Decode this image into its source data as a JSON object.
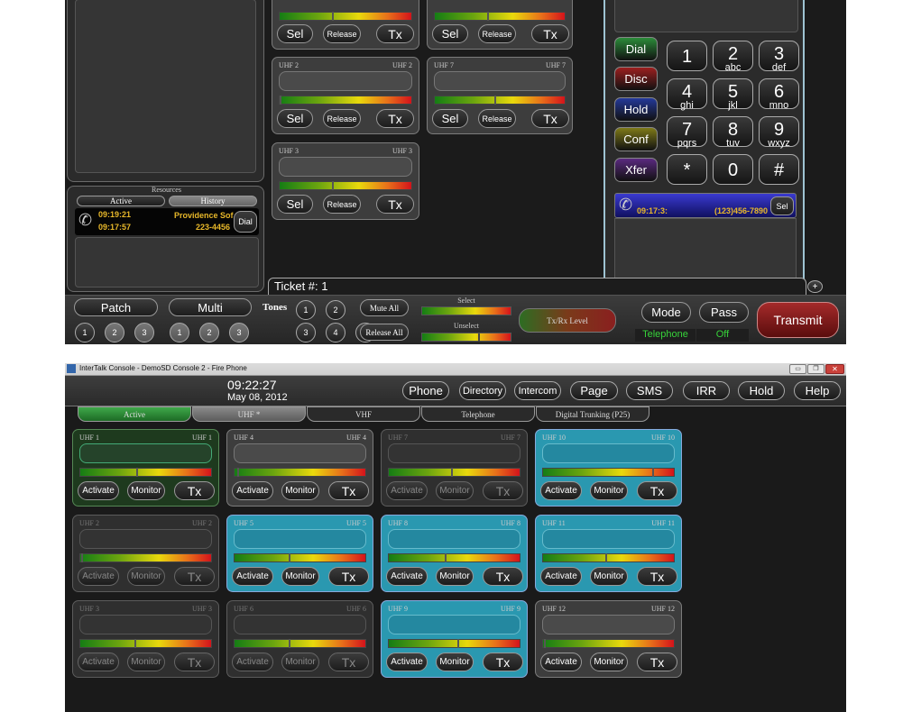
{
  "top": {
    "resources": {
      "title": "Resources",
      "tab_active": "Active",
      "tab_history": "History",
      "call": {
        "time1": "09:19:21",
        "time2": "09:17:57",
        "name": "Providence Sof",
        "number": "223-4456",
        "dial": "Dial"
      }
    },
    "channels": [
      {
        "left": "UHF 2",
        "right": "UHF 2",
        "sel": "Sel",
        "release": "Release",
        "tx": "Tx"
      },
      {
        "left": "UHF 7",
        "right": "UHF 7",
        "sel": "Sel",
        "release": "Release",
        "tx": "Tx"
      },
      {
        "left": "UHF 3",
        "right": "UHF 3",
        "sel": "Sel",
        "release": "Release",
        "tx": "Tx"
      }
    ],
    "partial_row": {
      "sel": "Sel",
      "release": "Release",
      "tx": "Tx"
    },
    "dialer": {
      "call_buttons": [
        "Dial",
        "Disc",
        "Hold",
        "Conf",
        "Xfer"
      ],
      "call_colors": [
        "#2c8c3a",
        "#9c1f1f",
        "#24399a",
        "#7f7a18",
        "#5a2a80"
      ],
      "keys": [
        {
          "n": "1",
          "l": ""
        },
        {
          "n": "2",
          "l": "abc"
        },
        {
          "n": "3",
          "l": "def"
        },
        {
          "n": "4",
          "l": "ghi"
        },
        {
          "n": "5",
          "l": "jkl"
        },
        {
          "n": "6",
          "l": "mno"
        },
        {
          "n": "7",
          "l": "pqrs"
        },
        {
          "n": "8",
          "l": "tuv"
        },
        {
          "n": "9",
          "l": "wxyz"
        },
        {
          "n": "*",
          "l": ""
        },
        {
          "n": "0",
          "l": ""
        },
        {
          "n": "#",
          "l": ""
        }
      ],
      "active_call": {
        "time": "09:17:3:",
        "number": "(123)456-7890",
        "sel": "Sel"
      }
    },
    "ticket": "Ticket #:  1",
    "plus": "+",
    "bottom": {
      "patch": "Patch",
      "multi": "Multi",
      "tones": "Tones",
      "patch_nums": [
        "1",
        "2",
        "3"
      ],
      "multi_nums": [
        "1",
        "2",
        "3"
      ],
      "tone_nums": [
        "1",
        "2",
        "3",
        "4",
        "5"
      ],
      "mute_all": "Mute All",
      "release_all": "Release All",
      "select": "Select",
      "unselect": "Unselect",
      "txrx": "Tx/Rx Level",
      "mode": "Mode",
      "pass": "Pass",
      "mode_value": "Telephone",
      "pass_value": "Off",
      "transmit": "Transmit"
    }
  },
  "bottom_window": {
    "title": "InterTalk Console - DemoSD Console 2 - Fire Phone",
    "time": "09:22:27",
    "date": "May 08, 2012",
    "nav": [
      "Phone",
      "Directory",
      "Intercom",
      "Page",
      "SMS",
      "IRR",
      "Hold",
      "Help"
    ],
    "tabs": [
      "Active",
      "UHF *",
      "VHF",
      "Telephone",
      "Digital Trunking (P25)"
    ],
    "cards": [
      {
        "name": "UHF 1",
        "state": "green",
        "level": 0.42,
        "activate": "Activate",
        "monitor": "Monitor",
        "tx": "Tx"
      },
      {
        "name": "UHF 4",
        "state": "normal",
        "level": 0.02,
        "activate": "Activate",
        "monitor": "Monitor",
        "tx": "Tx"
      },
      {
        "name": "UHF 7",
        "state": "dim",
        "level": 0.47,
        "activate": "Activate",
        "monitor": "Monitor",
        "tx": "Tx"
      },
      {
        "name": "UHF 10",
        "state": "blue",
        "level": 0.82,
        "activate": "Activate",
        "monitor": "Monitor",
        "tx": "Tx"
      },
      {
        "name": "UHF 2",
        "state": "dim",
        "level": 0.01,
        "activate": "Activate",
        "monitor": "Monitor",
        "tx": "Tx"
      },
      {
        "name": "UHF 5",
        "state": "blue",
        "level": 0.41,
        "activate": "Activate",
        "monitor": "Monitor",
        "tx": "Tx"
      },
      {
        "name": "UHF 8",
        "state": "blue",
        "level": 0.42,
        "activate": "Activate",
        "monitor": "Monitor",
        "tx": "Tx"
      },
      {
        "name": "UHF 11",
        "state": "blue",
        "level": 0.47,
        "activate": "Activate",
        "monitor": "Monitor",
        "tx": "Tx"
      },
      {
        "name": "UHF 3",
        "state": "dim",
        "level": 0.41,
        "activate": "Activate",
        "monitor": "Monitor",
        "tx": "Tx"
      },
      {
        "name": "UHF 6",
        "state": "dim",
        "level": 0.41,
        "activate": "Activate",
        "monitor": "Monitor",
        "tx": "Tx"
      },
      {
        "name": "UHF 9",
        "state": "blue",
        "level": 0.52,
        "activate": "Activate",
        "monitor": "Monitor",
        "tx": "Tx"
      },
      {
        "name": "UHF 12",
        "state": "normal",
        "level": 0.01,
        "activate": "Activate",
        "monitor": "Monitor",
        "tx": "Tx"
      }
    ]
  }
}
